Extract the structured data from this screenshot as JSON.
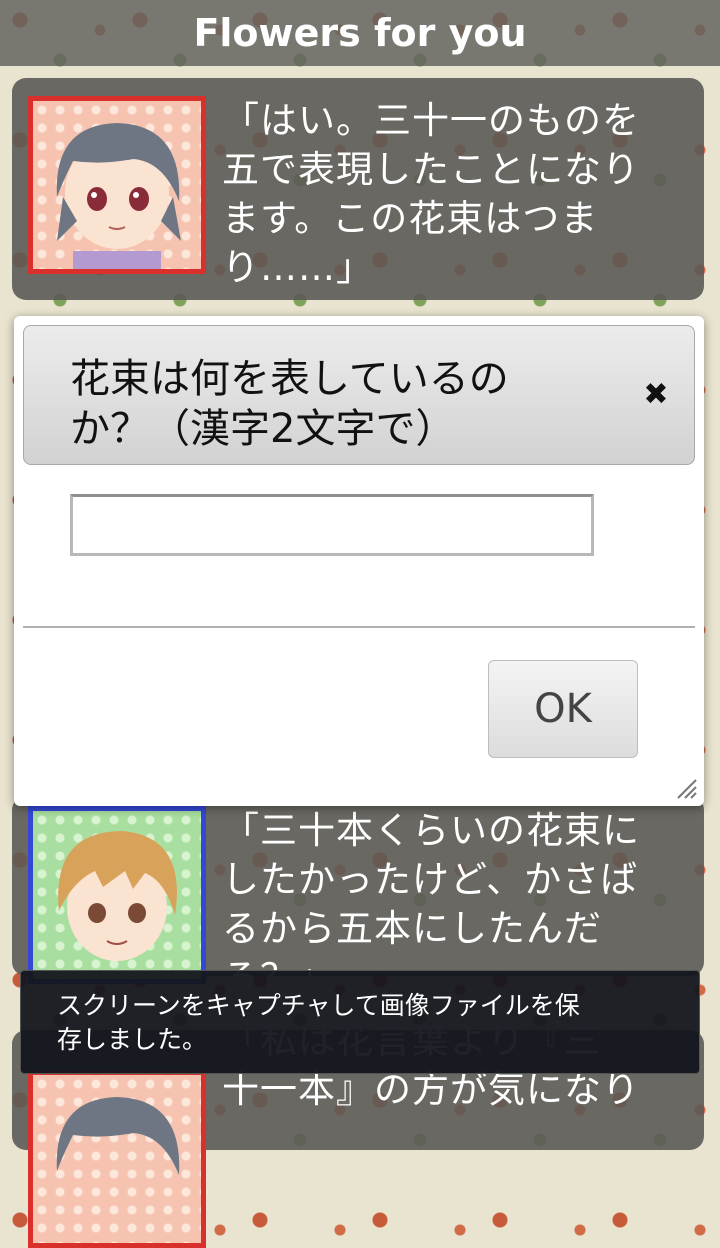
{
  "app": {
    "title": "Flowers for you"
  },
  "messages": [
    {
      "speaker": "girl",
      "text": "「はい。三十一のものを\n五で表現したことになり\nます。この花束はつま\nり……」"
    },
    {
      "speaker": "boy",
      "text": "「三十本くらいの花束に\nしたかったけど、かさば\nるから五本にしたんだ\nろ？」"
    },
    {
      "speaker": "girl",
      "text": "「私は花言葉より『三\n十一本』の方が気になり"
    }
  ],
  "dialog": {
    "title": "花束は何を表しているの\nか？（漢字2文字で）",
    "input_value": "",
    "ok_label": "OK",
    "close_symbol": "✖"
  },
  "toast": {
    "text": "スクリーンをキャプチャして画像ファイルを保\n存しました。"
  },
  "colors": {
    "girl_frame": "#d9302c",
    "boy_frame": "#3448d8"
  }
}
